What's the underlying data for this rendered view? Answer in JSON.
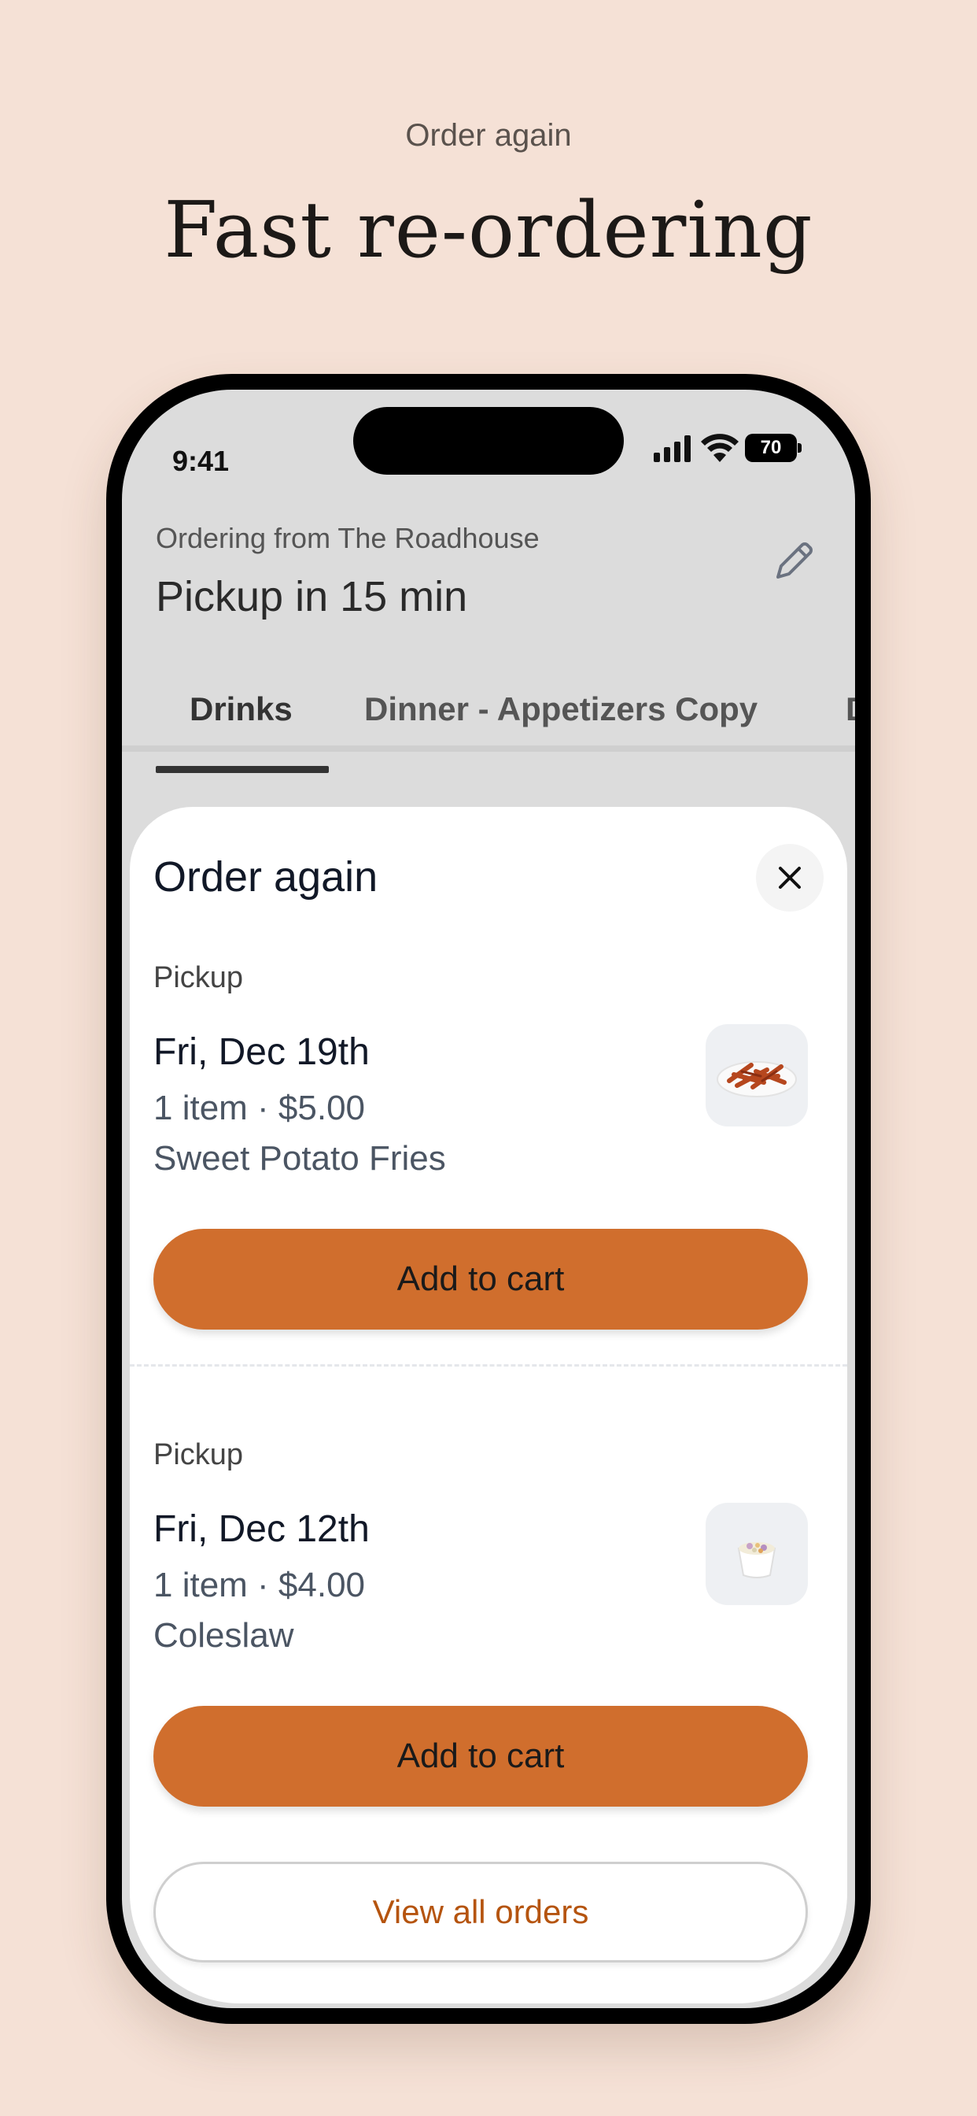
{
  "marketing": {
    "eyebrow": "Order again",
    "headline": "Fast re-ordering"
  },
  "status_bar": {
    "time": "9:41",
    "battery": "70"
  },
  "header": {
    "ordering_from": "Ordering from The Roadhouse",
    "pickup_time": "Pickup in 15 min"
  },
  "tabs": [
    {
      "label": "Drinks",
      "active": true
    },
    {
      "label": "Dinner - Appetizers Copy",
      "active": false
    },
    {
      "label": "D",
      "active": false
    }
  ],
  "sheet": {
    "title": "Order again",
    "orders": [
      {
        "type": "Pickup",
        "date": "Fri, Dec 19th",
        "meta": "1 item · $5.00",
        "items": "Sweet Potato Fries",
        "button": "Add to cart"
      },
      {
        "type": "Pickup",
        "date": "Fri, Dec 12th",
        "meta": "1 item · $4.00",
        "items": "Coleslaw",
        "button": "Add to cart"
      }
    ],
    "view_all": "View all orders"
  },
  "colors": {
    "background": "#f5e1d6",
    "accent": "#d06e2d",
    "link": "#b5540f"
  }
}
